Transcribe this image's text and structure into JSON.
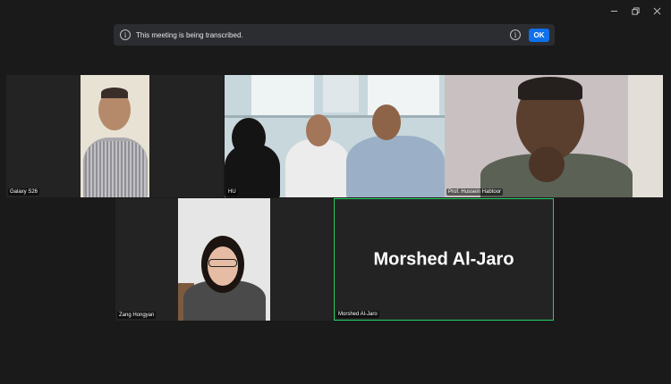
{
  "window_controls": {
    "minimize": "minimize",
    "restore": "restore",
    "close": "close"
  },
  "banner": {
    "message": "This meeting is being transcribed.",
    "ok_label": "OK"
  },
  "participants": [
    {
      "name": "Galaxy S26"
    },
    {
      "name": "HU"
    },
    {
      "name": "Prof. Hussein Habtoor"
    },
    {
      "name": "Zang Hongyan"
    },
    {
      "name": "Morshed Al-Jaro",
      "display_name": "Morshed Al-Jaro",
      "speaking": true
    }
  ]
}
